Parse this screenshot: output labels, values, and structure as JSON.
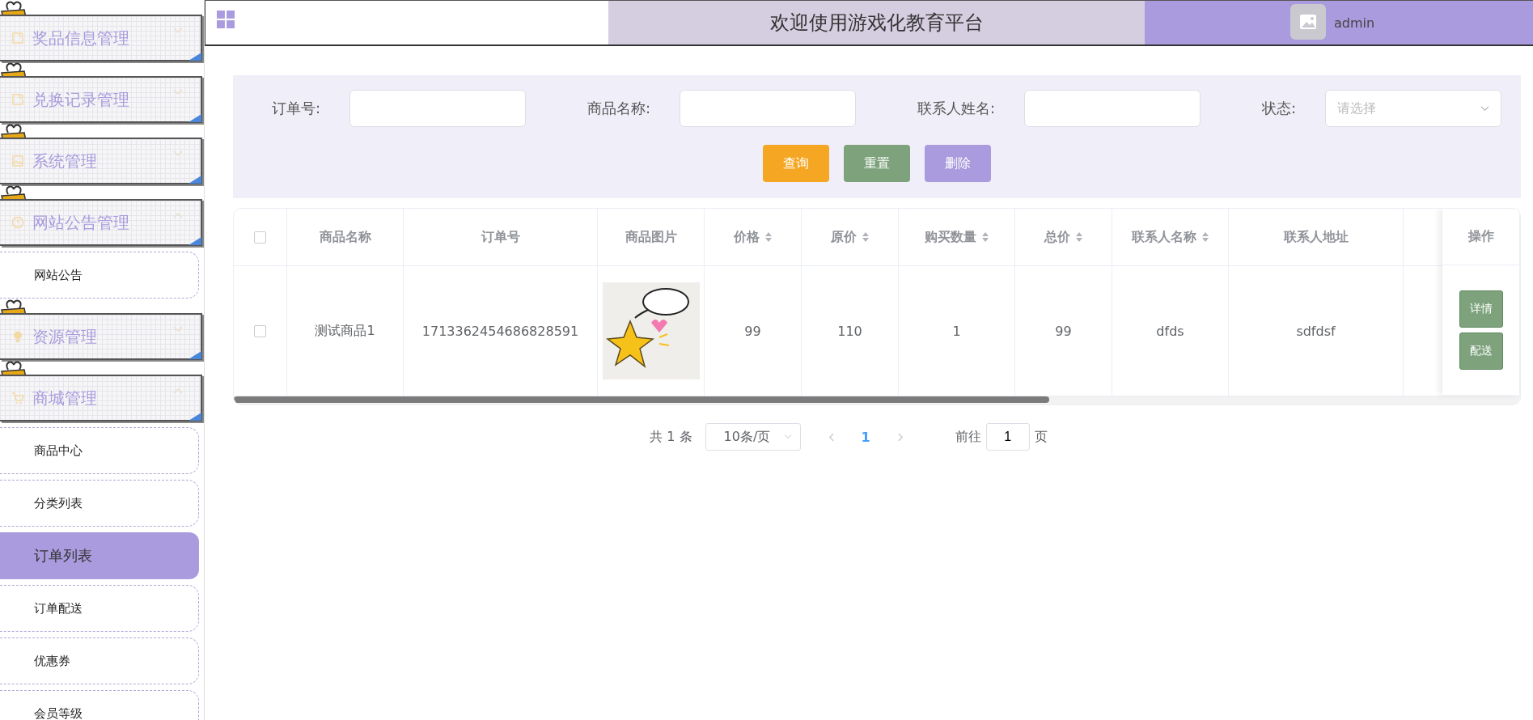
{
  "sidebar": {
    "groups": [
      {
        "title": "奖品信息管理",
        "expanded": false
      },
      {
        "title": "兑换记录管理",
        "expanded": false
      },
      {
        "title": "系统管理",
        "expanded": false
      },
      {
        "title": "网站公告管理",
        "expanded": true,
        "children": [
          {
            "label": "网站公告",
            "selected": false
          }
        ]
      },
      {
        "title": "资源管理",
        "expanded": false
      },
      {
        "title": "商城管理",
        "expanded": true,
        "children": [
          {
            "label": "商品中心",
            "selected": false
          },
          {
            "label": "分类列表",
            "selected": false
          },
          {
            "label": "订单列表",
            "selected": true
          },
          {
            "label": "订单配送",
            "selected": false
          },
          {
            "label": "优惠券",
            "selected": false
          },
          {
            "label": "会员等级",
            "selected": false
          }
        ]
      }
    ]
  },
  "header": {
    "title": "欢迎使用游戏化教育平台",
    "user": "admin"
  },
  "filters": [
    {
      "label": "订单号:",
      "kind": "input"
    },
    {
      "label": "商品名称:",
      "kind": "input"
    },
    {
      "label": "联系人姓名:",
      "kind": "input"
    },
    {
      "label": "状态:",
      "kind": "select",
      "placeholder": "请选择"
    }
  ],
  "actions": [
    {
      "label": "查询",
      "kind": "search"
    },
    {
      "label": "重置",
      "kind": "reset"
    },
    {
      "label": "删除",
      "kind": "delete"
    }
  ],
  "table": {
    "all_checked": false,
    "columns": [
      {
        "label": "商品名称",
        "sortable": false
      },
      {
        "label": "订单号",
        "sortable": false
      },
      {
        "label": "商品图片",
        "sortable": false
      },
      {
        "label": "价格",
        "sortable": true
      },
      {
        "label": "原价",
        "sortable": true
      },
      {
        "label": "购买数量",
        "sortable": true
      },
      {
        "label": "总价",
        "sortable": true
      },
      {
        "label": "联系人名称",
        "sortable": true
      },
      {
        "label": "联系人地址",
        "sortable": false
      }
    ],
    "action_column": "操作",
    "rows": [
      {
        "checked": false,
        "cells": [
          "测试商品1",
          "1713362454686828591",
          {
            "kind": "picture"
          },
          "99",
          "110",
          "1",
          "99",
          "dfds",
          "sdfdsf"
        ],
        "buttons": [
          "详情",
          "配送"
        ]
      }
    ]
  },
  "pagination": {
    "total": "共 1 条",
    "page_size": "10条/页",
    "pages": [
      {
        "label": "1",
        "selected": true
      }
    ],
    "goto": "前往",
    "goto_value": "1",
    "goto_suffix": "页"
  }
}
